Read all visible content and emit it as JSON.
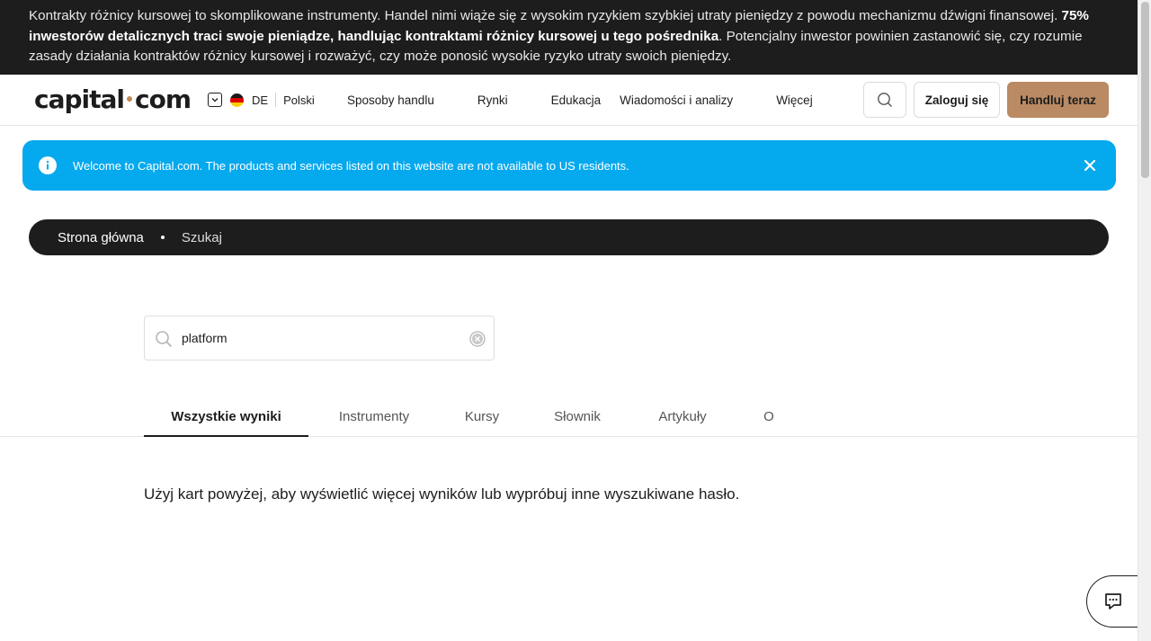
{
  "risk_warning": {
    "text_before": "Kontrakty różnicy kursowej to skomplikowane instrumenty. Handel nimi wiąże się z wysokim ryzykiem szybkiej utraty pieniędzy z powodu mechanizmu dźwigni finansowej. ",
    "text_bold": "75% inwestorów detalicznych traci swoje pieniądze, handlując kontraktami różnicy kursowej u tego pośrednika",
    "text_after": ". Potencjalny inwestor powinien zastanowić się, czy rozumie zasady działania kontraktów różnicy kursowej i rozważyć, czy może ponosić wysokie ryzyko utraty swoich pieniędzy."
  },
  "header": {
    "logo_left": "capital",
    "logo_right": "com",
    "country_code": "DE",
    "language": "Polski",
    "nav": [
      "Sposoby handlu",
      "Rynki",
      "Edukacja",
      "Wiadomości i analizy",
      "Więcej"
    ],
    "login_label": "Zaloguj się",
    "trade_label": "Handluj teraz"
  },
  "alert": {
    "text": "Welcome to Capital.com. The products and services listed on this website are not available to US residents."
  },
  "breadcrumb": {
    "home": "Strona główna",
    "current": "Szukaj"
  },
  "search": {
    "value": "platform"
  },
  "tabs": [
    "Wszystkie wyniki",
    "Instrumenty",
    "Kursy",
    "Słownik",
    "Artykuły",
    "O"
  ],
  "active_tab": "Wszystkie wyniki",
  "message": "Użyj kart powyżej, aby wyświetlić więcej wyników lub wypróbuj inne wyszukiwane hasło.",
  "colors": {
    "dark": "#1d1d1d",
    "alert_blue": "#05a9ee",
    "trade_button": "#b98a63",
    "logo_dot": "#c28a52"
  }
}
